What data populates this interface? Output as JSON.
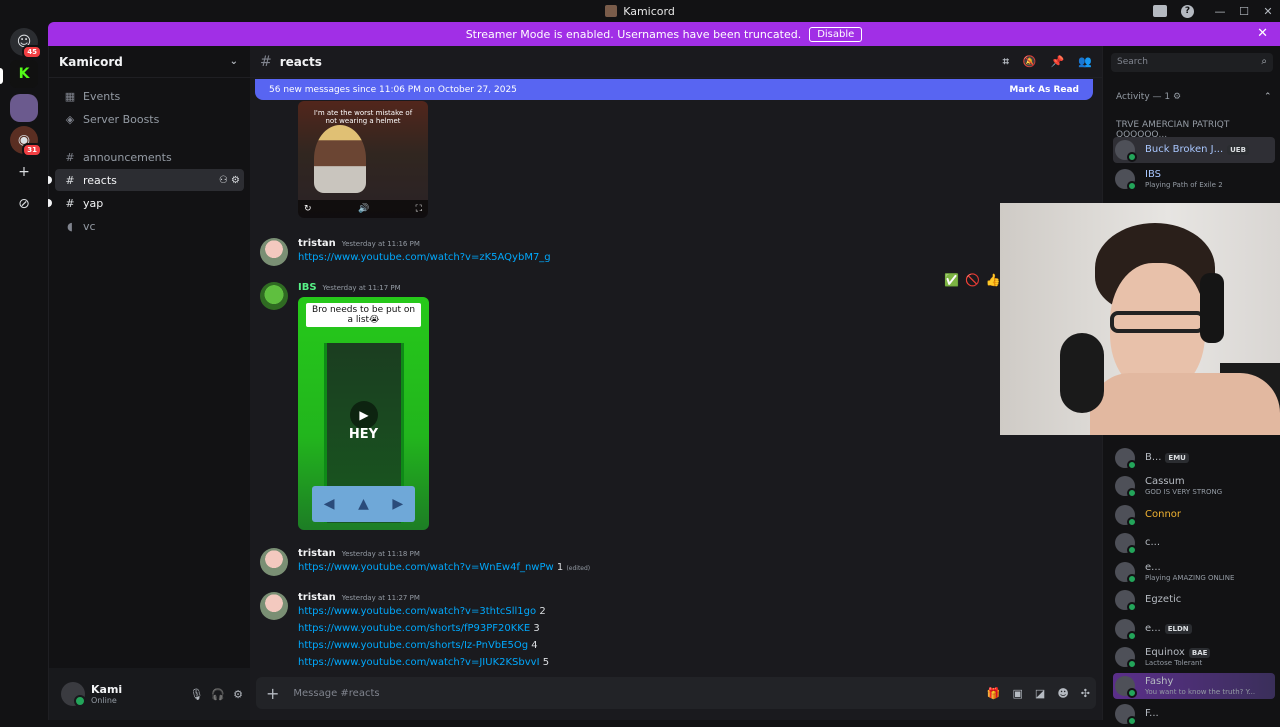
{
  "window": {
    "title": "Kamicord"
  },
  "banner": {
    "text": "Streamer Mode is enabled. Usernames have been truncated.",
    "disable_label": "Disable"
  },
  "guilds": [
    {
      "name": "home",
      "badge": "45"
    },
    {
      "name": "kick",
      "badge": ""
    },
    {
      "name": "kamicord",
      "badge": ""
    },
    {
      "name": "server-3",
      "badge": "31"
    }
  ],
  "server": {
    "name": "Kamicord",
    "nav": [
      {
        "label": "Events",
        "icon": "calendar-icon"
      },
      {
        "label": "Server Boosts",
        "icon": "boost-icon"
      }
    ],
    "channels": [
      {
        "label": "announcements",
        "type": "text"
      },
      {
        "label": "reacts",
        "type": "text",
        "active": true
      },
      {
        "label": "yap",
        "type": "text",
        "unread": true
      },
      {
        "label": "vc",
        "type": "voice"
      }
    ]
  },
  "user": {
    "name": "Kami",
    "status": "Online"
  },
  "channel": {
    "name": "reacts"
  },
  "new_messages": {
    "text": "56 new messages since 11:06 PM on October 27, 2025",
    "mark_label": "Mark As Read"
  },
  "messages": [
    {
      "author": "tristan",
      "time": "Yesterday at 11:16 PM",
      "lines": [
        {
          "url": "https://www.youtube.com/watch?v=zK5AQybM7_g",
          "num": ""
        }
      ]
    },
    {
      "author": "IBS",
      "time": "Yesterday at 11:17 PM",
      "video_caption": "Bro needs to be put on a list😭",
      "video_text": "HEY"
    },
    {
      "author": "tristan",
      "time": "Yesterday at 11:18 PM",
      "lines": [
        {
          "url": "https://www.youtube.com/watch?v=WnEw4f_nwPw",
          "num": "1",
          "edited": "(edited)"
        }
      ]
    },
    {
      "author": "tristan",
      "time": "Yesterday at 11:27 PM",
      "lines": [
        {
          "url": "https://www.youtube.com/watch?v=3thtcSll1go",
          "num": "2"
        },
        {
          "url": "https://www.youtube.com/shorts/fP93PF20KKE",
          "num": "3"
        },
        {
          "url": "https://www.youtube.com/shorts/Iz-PnVbE5Og",
          "num": "4"
        },
        {
          "url": "https://www.youtube.com/watch?v=JIUK2KSbvvI",
          "num": "5"
        }
      ]
    }
  ],
  "video1_caption": "I'm ate the worst mistake of not wearing a helmet",
  "composer": {
    "placeholder": "Message #reacts"
  },
  "members": {
    "search_placeholder": "Search",
    "activity_label": "Activity — 1",
    "group_label": "TRVE AMERCIAN PATRIQT QQQQQQ...",
    "list": [
      {
        "name": "Buck Broken J...",
        "tag": "UEB",
        "sub": "",
        "color": "#a9c7ff",
        "hl": true
      },
      {
        "name": "IBS",
        "tag": "",
        "sub": "Playing Path of Exile 2",
        "color": "#a9c7ff"
      },
      {
        "name": "B...",
        "tag": "EMU",
        "sub": "",
        "color": "#b5bac1"
      },
      {
        "name": "Cassum",
        "tag": "",
        "sub": "GOD IS VERY STRONG",
        "color": "#b5bac1"
      },
      {
        "name": "Connor",
        "tag": "",
        "sub": "",
        "color": "#f0b232"
      },
      {
        "name": "c...",
        "tag": "",
        "sub": "",
        "color": "#b5bac1"
      },
      {
        "name": "e...",
        "tag": "",
        "sub": "Playing AMAZING ONLINE",
        "color": "#b5bac1"
      },
      {
        "name": "Egzetic",
        "tag": "",
        "sub": "",
        "color": "#b5bac1"
      },
      {
        "name": "e...",
        "tag": "ELDN",
        "sub": "",
        "color": "#b5bac1"
      },
      {
        "name": "Equinox",
        "tag": "BAE",
        "sub": "Lactose Tolerant",
        "color": "#b5bac1"
      },
      {
        "name": "Fashy",
        "tag": "",
        "sub": "You want to know the truth? Y...",
        "color": "#b5bac1",
        "fashy": true
      },
      {
        "name": "F...",
        "tag": "",
        "sub": "",
        "color": "#b5bac1"
      }
    ]
  }
}
